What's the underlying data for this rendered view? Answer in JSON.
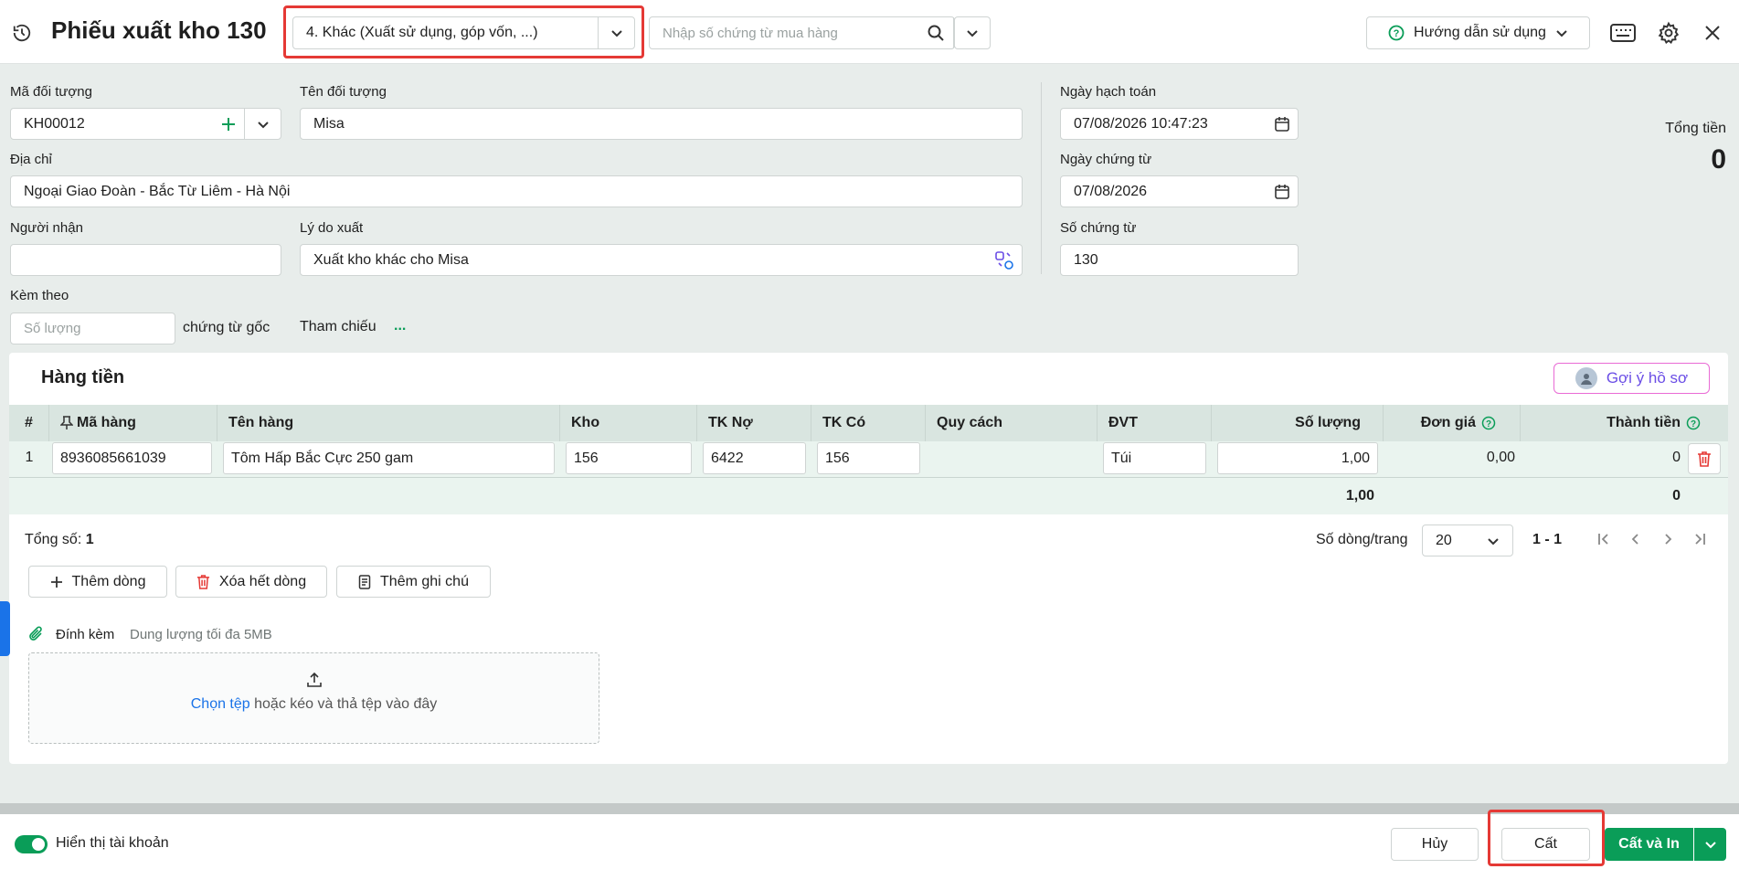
{
  "header": {
    "title": "Phiếu xuất kho 130",
    "export_type": "4. Khác (Xuất sử dụng, góp vốn, ...)",
    "purchase_search_placeholder": "Nhập số chứng từ mua hàng",
    "help_label": "Hướng dẫn sử dụng"
  },
  "form": {
    "ma_doi_tuong_label": "Mã đối tượng",
    "ma_doi_tuong_value": "KH00012",
    "ten_doi_tuong_label": "Tên đối tượng",
    "ten_doi_tuong_value": "Misa",
    "dia_chi_label": "Địa chỉ",
    "dia_chi_value": "Ngoại Giao Đoàn - Bắc Từ Liêm - Hà Nội",
    "nguoi_nhan_label": "Người nhận",
    "nguoi_nhan_value": "",
    "ly_do_label": "Lý do xuất",
    "ly_do_value": "Xuất kho khác cho Misa",
    "kem_theo_label": "Kèm theo",
    "so_luong_placeholder": "Số lượng",
    "chung_tu_goc_label": "chứng từ gốc",
    "tham_chieu_label": "Tham chiếu",
    "tham_chieu_more": "...",
    "ngay_hach_toan_label": "Ngày hạch toán",
    "ngay_hach_toan_value": "07/08/2026 10:47:23",
    "ngay_chung_tu_label": "Ngày chứng từ",
    "ngay_chung_tu_value": "07/08/2026",
    "so_chung_tu_label": "Số chứng từ",
    "so_chung_tu_value": "130",
    "tong_tien_label": "Tổng tiền",
    "tong_tien_value": "0"
  },
  "goods": {
    "section_title": "Hàng tiền",
    "suggest_label": "Gợi ý hồ sơ",
    "columns": [
      "#",
      "Mã hàng",
      "Tên hàng",
      "Kho",
      "TK Nợ",
      "TK Có",
      "Quy cách",
      "ĐVT",
      "Số lượng",
      "Đơn giá",
      "Thành tiền"
    ],
    "rows": [
      {
        "no": "1",
        "ma_hang": "8936085661039",
        "ten_hang": "Tôm Hấp Bắc Cực 250 gam",
        "kho": "156",
        "tk_no": "6422",
        "tk_co": "156",
        "quy_cach": "",
        "dvt": "Túi",
        "so_luong": "1,00",
        "don_gia": "0,00",
        "thanh_tien": "0"
      }
    ],
    "total_so_luong": "1,00",
    "total_thanh_tien": "0",
    "tong_so_label": "Tổng số:",
    "tong_so_value": "1",
    "rows_per_page_label": "Số dòng/trang",
    "rows_per_page_value": "20",
    "page_range": "1 - 1",
    "add_row": "Thêm dòng",
    "delete_all": "Xóa hết dòng",
    "add_note": "Thêm ghi chú"
  },
  "attachment": {
    "label": "Đính kèm",
    "limit": "Dung lượng tối đa 5MB",
    "choose_file": "Chọn tệp",
    "drop_text": "hoặc kéo và thả tệp vào đây"
  },
  "footer": {
    "show_account_label": "Hiển thị tài khoản",
    "cancel": "Hủy",
    "save": "Cất",
    "save_print": "Cất và In"
  },
  "colors": {
    "accent": "#0a9d58",
    "highlight": "#e53935",
    "link": "#1a73e8"
  }
}
